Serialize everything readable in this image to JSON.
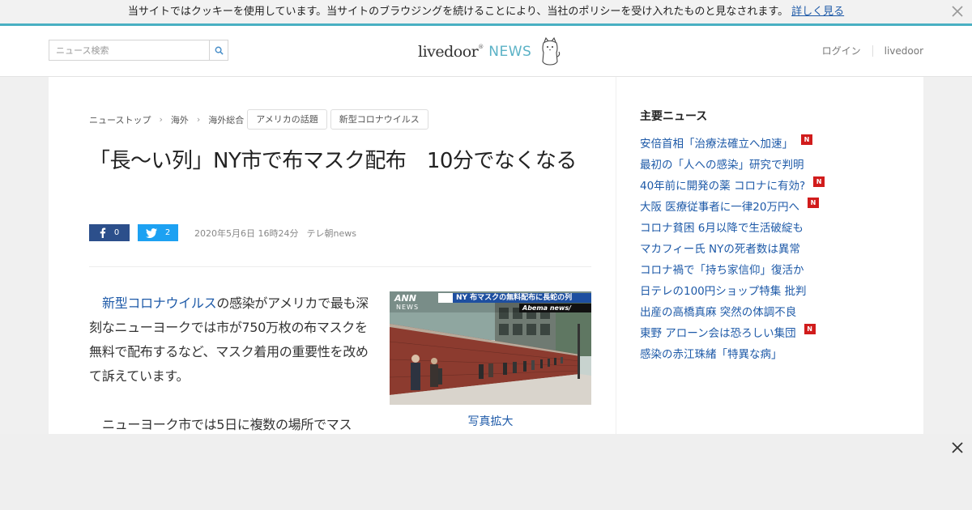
{
  "cookie": {
    "text": "当サイトではクッキーを使用しています。当サイトのブラウジングを続けることにより、当社のポリシーを受け入れたものと見なされます。",
    "more_link": "詳しく見る",
    "accent_color": "#49b0c2"
  },
  "header": {
    "search_placeholder": "ニュース検索",
    "logo_main": "livedoor",
    "logo_mark": "®",
    "logo_sub": "NEWS",
    "nav": [
      "ログイン",
      "livedoor"
    ]
  },
  "breadcrumb": {
    "items": [
      "ニューストップ",
      "海外",
      "海外総合"
    ],
    "tags": [
      "アメリカの話題",
      "新型コロナウイルス"
    ]
  },
  "article": {
    "title": "「長～い列」NY市で布マスク配布　10分でなくなる",
    "facebook_count": "0",
    "twitter_count": "2",
    "date": "2020年5月6日 16時24分",
    "source": "テレ朝news",
    "para1_link": "新型コロナウイルス",
    "para1_rest": "の感染がアメリカで最も深刻なニューヨークでは市が750万枚の布マスクを無料で配布するなど、マスク着用の重要性を改めて訴えています。",
    "para2": "ニューヨーク市では5日に複数の場所でマス",
    "photo_caption": "写真拡大",
    "photo_overlay": {
      "ann": "ANN",
      "news": "NEWS",
      "headline": "NY 布マスクの無料配布に長蛇の列",
      "brand": "Abema news/"
    }
  },
  "sidebar": {
    "title": "主要ニュース",
    "new_badge": "N",
    "items": [
      {
        "text": "安倍首相「治療法確立へ加速」",
        "new": true
      },
      {
        "text": "最初の「人への感染」研究で判明",
        "new": false
      },
      {
        "text": "40年前に開発の薬 コロナに有効?",
        "new": true
      },
      {
        "text": "大阪 医療従事者に一律20万円へ",
        "new": true
      },
      {
        "text": "コロナ貧困 6月以降で生活破綻も",
        "new": false
      },
      {
        "text": "マカフィー氏 NYの死者数は異常",
        "new": false
      },
      {
        "text": "コロナ禍で「持ち家信仰」復活か",
        "new": false
      },
      {
        "text": "日テレの100円ショップ特集 批判",
        "new": false
      },
      {
        "text": "出産の高橋真麻 突然の体調不良",
        "new": false
      },
      {
        "text": "東野 アローン会は恐ろしい集団",
        "new": true
      },
      {
        "text": "感染の赤江珠緒「特異な病」",
        "new": false
      }
    ]
  },
  "icons": {
    "cookie_close": "close-icon",
    "search": "search-icon",
    "logo_dog": "dog-mascot-icon",
    "facebook": "facebook-icon",
    "twitter": "twitter-icon",
    "ad_close": "close-icon"
  }
}
